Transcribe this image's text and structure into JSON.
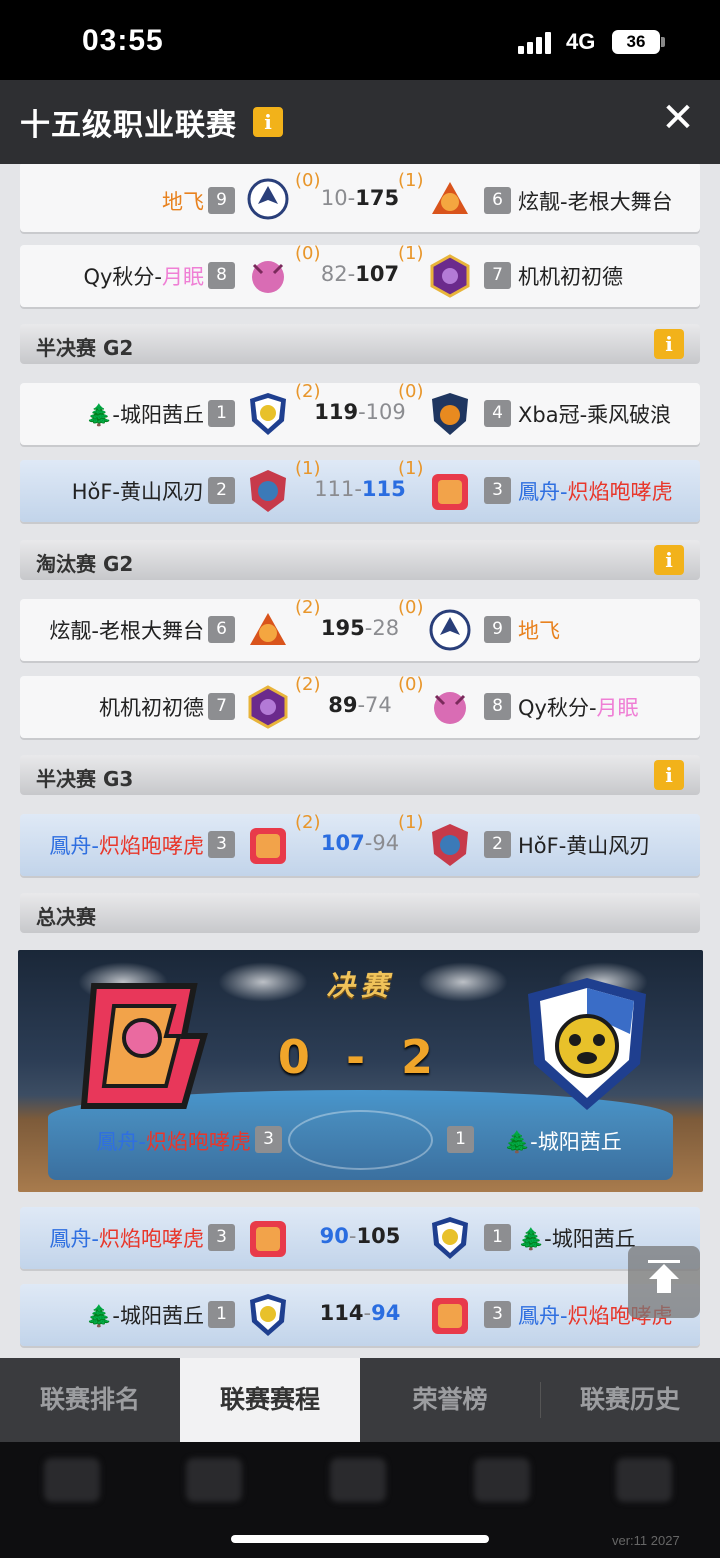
{
  "status": {
    "time": "03:55",
    "network": "4G",
    "battery": "36"
  },
  "header": {
    "title": "十五级职业联赛",
    "info": "i"
  },
  "matches_top": [
    {
      "left_name": "地飞",
      "left_seed": "9",
      "left_wins": "(0)",
      "score_left": "10",
      "score_right": "175",
      "right_wins": "(1)",
      "right_seed": "6",
      "right_name": "炫靓-老根大舞台"
    },
    {
      "left_name_a": "Qy秋分-",
      "left_name_b": "月眠",
      "left_seed": "8",
      "left_wins": "(0)",
      "score_left": "82",
      "score_right": "107",
      "right_wins": "(1)",
      "right_seed": "7",
      "right_name": "机机初初德"
    }
  ],
  "sections": {
    "semi_g2": "半决赛 G2",
    "elim_g2": "淘汰赛 G2",
    "semi_g3": "半决赛 G3",
    "final": "总决赛"
  },
  "semi_g2": [
    {
      "left_name": "🌲-城阳茜丘",
      "left_seed": "1",
      "left_wins": "(2)",
      "score_left": "119",
      "score_right": "109",
      "right_wins": "(0)",
      "right_seed": "4",
      "right_name": "Xba冠-乘风破浪"
    },
    {
      "left_name": "HǒF-黄山风刃",
      "left_seed": "2",
      "left_wins": "(1)",
      "score_left": "111",
      "score_right": "115",
      "right_wins": "(1)",
      "right_seed": "3",
      "right_name_a": "鳳舟-",
      "right_name_b": "炽焰咆哮虎"
    }
  ],
  "elim_g2": [
    {
      "left_name": "炫靓-老根大舞台",
      "left_seed": "6",
      "left_wins": "(2)",
      "score_left": "195",
      "score_right": "28",
      "right_wins": "(0)",
      "right_seed": "9",
      "right_name": "地飞"
    },
    {
      "left_name": "机机初初德",
      "left_seed": "7",
      "left_wins": "(2)",
      "score_left": "89",
      "score_right": "74",
      "right_wins": "(0)",
      "right_seed": "8",
      "right_name_a": "Qy秋分-",
      "right_name_b": "月眠"
    }
  ],
  "semi_g3": [
    {
      "left_name_a": "鳳舟-",
      "left_name_b": "炽焰咆哮虎",
      "left_seed": "3",
      "left_wins": "(2)",
      "score_left": "107",
      "score_right": "94",
      "right_wins": "(1)",
      "right_seed": "2",
      "right_name": "HǒF-黄山风刃"
    }
  ],
  "final_banner": {
    "title": "决赛",
    "score": "0 - 2",
    "left_name_a": "鳳舟-",
    "left_name_b": "炽焰咆哮虎",
    "left_seed": "3",
    "right_seed": "1",
    "right_name": "🌲-城阳茜丘"
  },
  "final_games": [
    {
      "left_name_a": "鳳舟-",
      "left_name_b": "炽焰咆哮虎",
      "left_seed": "3",
      "score_left": "90",
      "score_right": "105",
      "right_seed": "1",
      "right_name": "🌲-城阳茜丘"
    },
    {
      "left_name": "🌲-城阳茜丘",
      "left_seed": "1",
      "score_left": "114",
      "score_right": "94",
      "right_seed": "3",
      "right_name_a": "鳳舟-",
      "right_name_b": "炽焰咆哮虎"
    }
  ],
  "tabs": [
    "联赛排名",
    "联赛赛程",
    "荣誉榜",
    "联赛历史"
  ],
  "version": "ver:11  2027",
  "colors": {
    "accent_orange": "#e8821f",
    "accent_blue": "#2a6de0",
    "accent_red": "#e8372b",
    "pink": "#ef7fd5",
    "badge_yellow": "#f2b21a"
  }
}
